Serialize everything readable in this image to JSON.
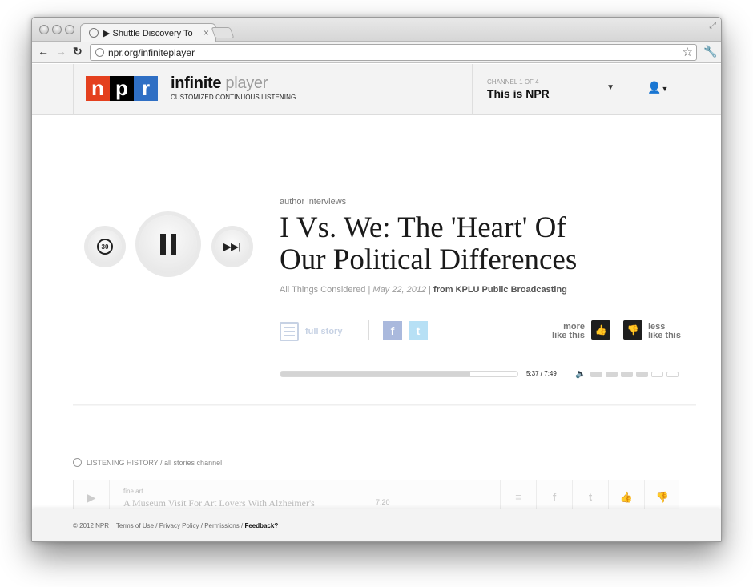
{
  "browser": {
    "tab_title": "▶ Shuttle Discovery To",
    "url": "npr.org/infiniteplayer"
  },
  "header": {
    "logo_letters": [
      "n",
      "p",
      "r"
    ],
    "brand_bold": "infinite",
    "brand_light": "player",
    "brand_sub": "CUSTOMIZED CONTINUOUS LISTENING",
    "channel_label": "CHANNEL 1 OF 4",
    "channel_name": "This is NPR"
  },
  "player": {
    "back_label": "30",
    "kicker": "author interviews",
    "headline": "I Vs. We: The 'Heart' Of Our Political Differences",
    "program": "All Things Considered",
    "date": "May 22, 2012",
    "source": "from KPLU Public Broadcasting",
    "full_story": "full story",
    "more_line1": "more",
    "more_line2": "like this",
    "less_line1": "less",
    "less_line2": "like this",
    "time": "5:37 / 7:49",
    "progress_fraction": 0.8,
    "volume_level": 4,
    "volume_segments": 6
  },
  "history": {
    "heading": "LISTENING HISTORY",
    "channel": "/ all stories channel",
    "items": [
      {
        "kicker": "fine art",
        "title": "A Museum Visit For Art Lovers With Alzheimer's",
        "duration": "7:20"
      }
    ]
  },
  "footer": {
    "copyright": "© 2012 NPR",
    "terms": "Terms of Use",
    "privacy": "Privacy Policy",
    "permissions": "Permissions",
    "feedback": "Feedback?"
  },
  "colors": {
    "npr_red": "#e4401e",
    "npr_black": "#000000",
    "npr_blue": "#2f6fc4",
    "thumb_dark": "#1e1e1e",
    "facebook_muted": "#aab9dd",
    "twitter_muted": "#b7e0f5"
  },
  "icons": [
    "globe-icon",
    "close-icon",
    "back-arrow-icon",
    "forward-arrow-icon",
    "reload-icon",
    "star-icon",
    "wrench-icon",
    "user-icon",
    "chevron-down-icon",
    "replay-30-icon",
    "pause-icon",
    "skip-next-icon",
    "story-icon",
    "facebook-icon",
    "twitter-icon",
    "thumbs-up-icon",
    "thumbs-down-icon",
    "volume-icon",
    "clock-icon",
    "play-icon"
  ]
}
